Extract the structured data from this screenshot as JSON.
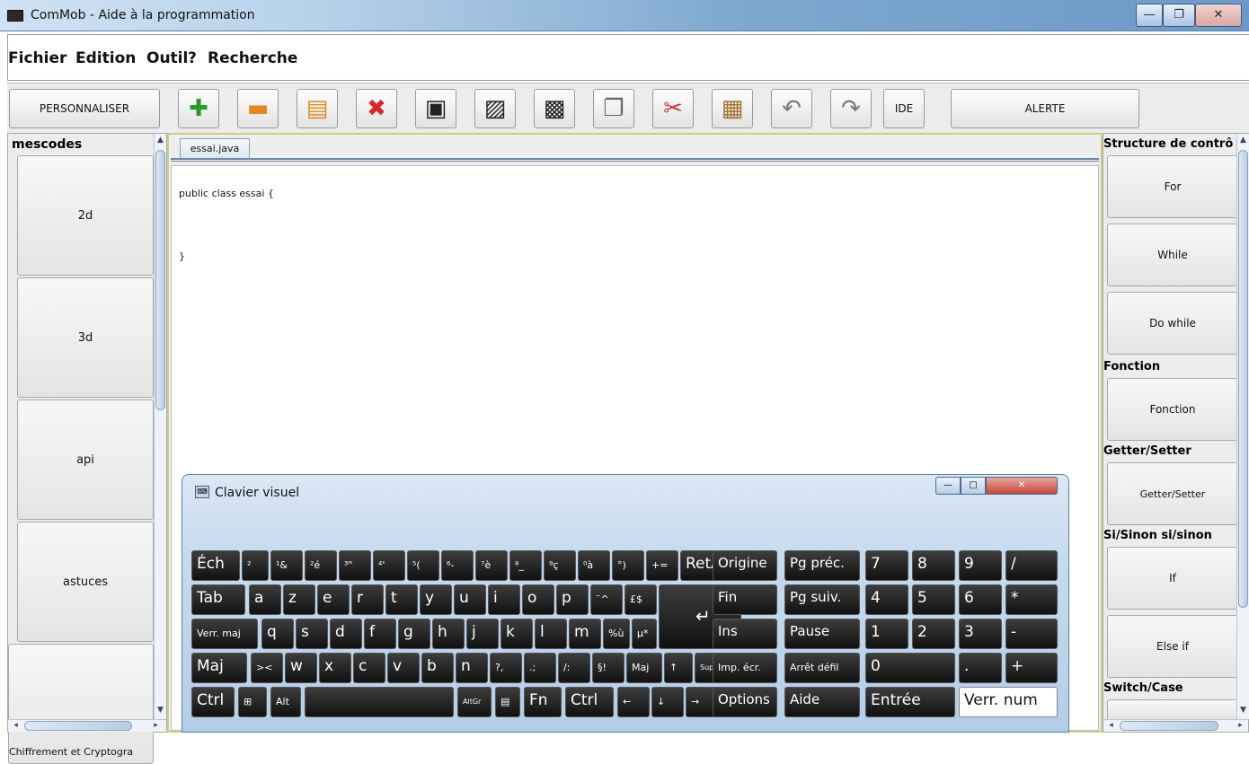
{
  "window": {
    "title": "ComMob - Aide à la programmation",
    "min": "—",
    "max": "❐",
    "close": "✕"
  },
  "menu": [
    "Fichier",
    "Edition",
    "Outil",
    "?",
    "Recherche"
  ],
  "toolbar": {
    "personnaliser": "PERSONNALISER",
    "ide": "IDE",
    "alerte": "ALERTE"
  },
  "left": {
    "title": "mescodes",
    "items": [
      "2d",
      "3d",
      "api",
      "astuces",
      "Chiffrement et Cryptogra"
    ]
  },
  "editor": {
    "tab": "essai.java",
    "lines": [
      "public class essai {",
      "}"
    ]
  },
  "right": {
    "sections": [
      "Structure de contrô",
      "Fonction",
      "Getter/Setter",
      "Si/Sinon si/sinon",
      "Switch/Case"
    ],
    "buttons": [
      "For",
      "While",
      "Do while",
      "Fonction",
      "Getter/Setter",
      "If",
      "Else if"
    ]
  },
  "keyboard": {
    "title": "Clavier visuel",
    "rows": [
      [
        "Éch",
        "²",
        "¹&",
        "²é",
        "³\"",
        "⁴'",
        "⁵(",
        "⁶-",
        "⁷è",
        "⁸_",
        "⁹ç",
        "⁰à",
        "°)",
        "+=",
        "RetArr"
      ],
      [
        "Tab",
        "a",
        "z",
        "e",
        "r",
        "t",
        "y",
        "u",
        "i",
        "o",
        "p",
        "¨^",
        "£$"
      ],
      [
        "Verr. maj",
        "q",
        "s",
        "d",
        "f",
        "g",
        "h",
        "j",
        "k",
        "l",
        "m",
        "%ù",
        "µ*"
      ],
      [
        "Maj",
        ">< ",
        "w",
        "x",
        "c",
        "v",
        "b",
        "n",
        "?,",
        ".;",
        "/:",
        "§!",
        "Maj",
        "↑",
        "Suppr"
      ],
      [
        "Ctrl",
        "⊞",
        "Alt",
        "",
        "AltGr",
        "▤",
        "Fn",
        "Ctrl",
        "←",
        "↓",
        "→"
      ]
    ],
    "nav": [
      [
        "Origine",
        "Pg préc."
      ],
      [
        "Fin",
        "Pg suiv."
      ],
      [
        "Ins",
        "Pause"
      ],
      [
        "Imp. écr.",
        "Arrêt défil"
      ],
      [
        "Options",
        "Aide"
      ]
    ],
    "numpad": [
      [
        "7",
        "8",
        "9",
        "/"
      ],
      [
        "4",
        "5",
        "6",
        "*"
      ],
      [
        "1",
        "2",
        "3",
        "-"
      ],
      [
        "0",
        ".",
        "+"
      ],
      [
        "Entrée",
        "Verr. num"
      ]
    ]
  }
}
